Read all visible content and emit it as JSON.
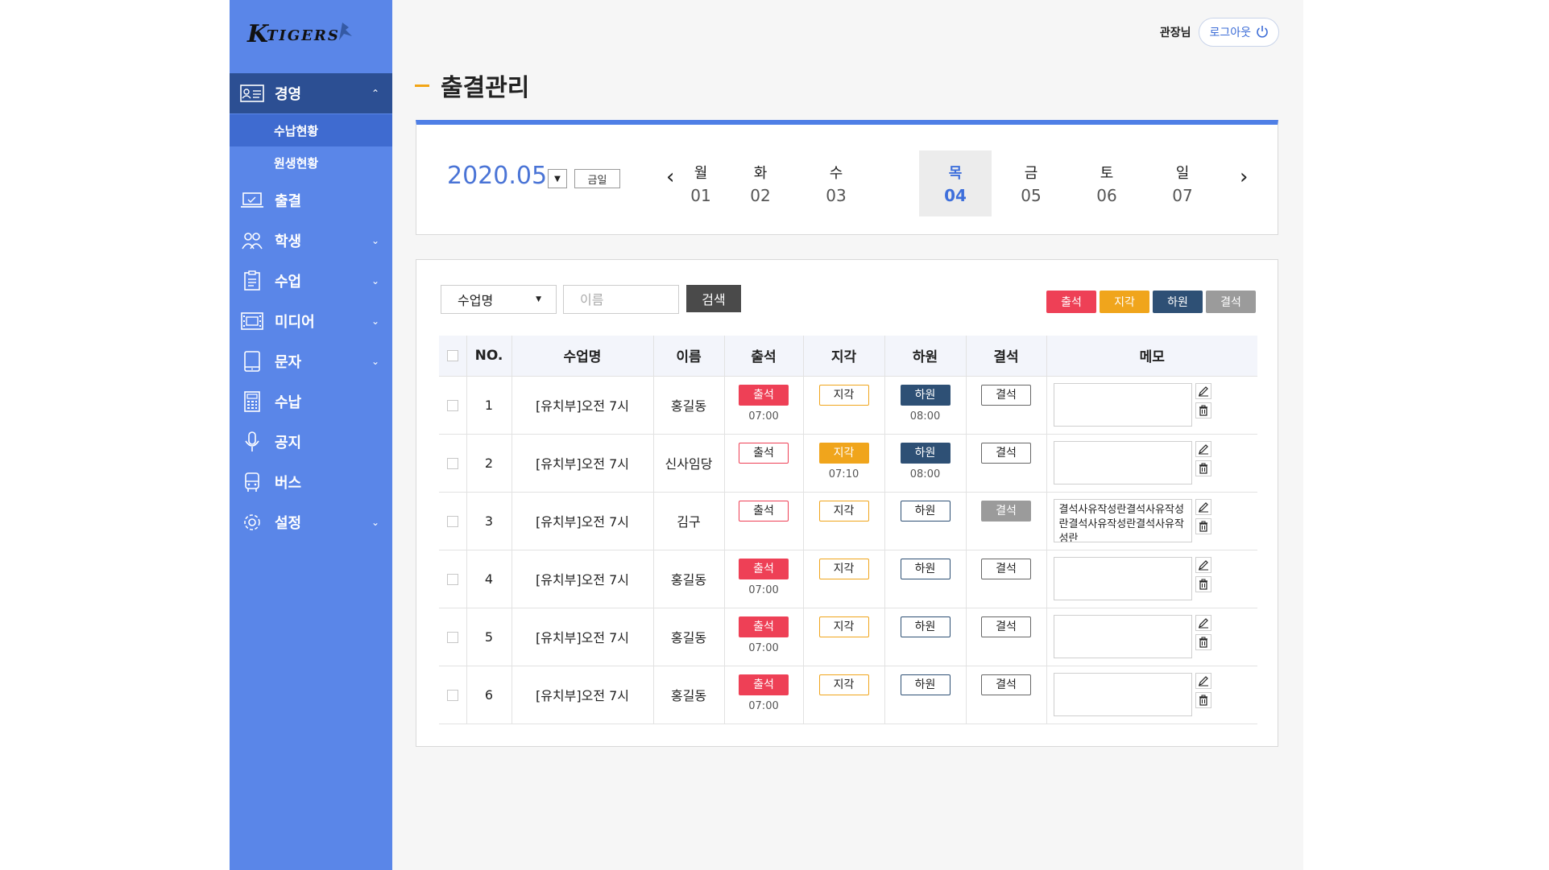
{
  "brand": {
    "logo_text": "K TIGERS"
  },
  "header": {
    "user": "관장님",
    "logout_label": "로그아웃"
  },
  "sidebar": {
    "items": [
      {
        "label": "경영",
        "icon": "id-card-icon",
        "expanded": true,
        "sub": [
          "수납현황",
          "원생현황"
        ]
      },
      {
        "label": "출결",
        "icon": "laptop-icon"
      },
      {
        "label": "학생",
        "icon": "users-icon",
        "has_children": true
      },
      {
        "label": "수업",
        "icon": "clipboard-icon",
        "has_children": true
      },
      {
        "label": "미디어",
        "icon": "media-icon",
        "has_children": true
      },
      {
        "label": "문자",
        "icon": "tablet-icon",
        "has_children": true
      },
      {
        "label": "수납",
        "icon": "calculator-icon"
      },
      {
        "label": "공지",
        "icon": "microphone-icon"
      },
      {
        "label": "버스",
        "icon": "bus-icon"
      },
      {
        "label": "설정",
        "icon": "gear-icon",
        "has_children": true
      }
    ]
  },
  "page": {
    "title": "출결관리"
  },
  "calendar": {
    "month": "2020.05",
    "today_label": "금일",
    "days": [
      {
        "dow": "월",
        "num": "01"
      },
      {
        "dow": "화",
        "num": "02"
      },
      {
        "dow": "수",
        "num": "03"
      },
      {
        "dow": "목",
        "num": "04",
        "selected": true
      },
      {
        "dow": "금",
        "num": "05"
      },
      {
        "dow": "토",
        "num": "06"
      },
      {
        "dow": "일",
        "num": "07"
      }
    ]
  },
  "filters": {
    "class_select": "수업명",
    "name_placeholder": "이름",
    "search_label": "검색"
  },
  "legend": [
    {
      "label": "출석",
      "color": "#ee4056"
    },
    {
      "label": "지각",
      "color": "#f0a51c"
    },
    {
      "label": "하원",
      "color": "#2e5075"
    },
    {
      "label": "결석",
      "color": "#9b9b9b"
    }
  ],
  "table": {
    "columns": [
      "NO.",
      "수업명",
      "이름",
      "출석",
      "지각",
      "하원",
      "결석",
      "메모"
    ],
    "button_labels": {
      "attend": "출석",
      "late": "지각",
      "leave": "하원",
      "absent": "결석"
    },
    "rows": [
      {
        "no": "1",
        "class": "[유치부]오전 7시",
        "name": "홍길동",
        "attend": true,
        "attend_time": "07:00",
        "late": false,
        "late_time": "",
        "leave": true,
        "leave_time": "08:00",
        "absent": false,
        "memo": ""
      },
      {
        "no": "2",
        "class": "[유치부]오전 7시",
        "name": "신사임당",
        "attend": false,
        "attend_time": "",
        "late": true,
        "late_time": "07:10",
        "leave": true,
        "leave_time": "08:00",
        "absent": false,
        "memo": ""
      },
      {
        "no": "3",
        "class": "[유치부]오전 7시",
        "name": "김구",
        "attend": false,
        "attend_time": "",
        "late": false,
        "late_time": "",
        "leave": false,
        "leave_time": "",
        "absent": true,
        "memo": "결석사유작성란결석사유작성란결석사유작성란결석사유작성란"
      },
      {
        "no": "4",
        "class": "[유치부]오전 7시",
        "name": "홍길동",
        "attend": true,
        "attend_time": "07:00",
        "late": false,
        "late_time": "",
        "leave": false,
        "leave_time": "",
        "absent": false,
        "memo": ""
      },
      {
        "no": "5",
        "class": "[유치부]오전 7시",
        "name": "홍길동",
        "attend": true,
        "attend_time": "07:00",
        "late": false,
        "late_time": "",
        "leave": false,
        "leave_time": "",
        "absent": false,
        "memo": ""
      },
      {
        "no": "6",
        "class": "[유치부]오전 7시",
        "name": "홍길동",
        "attend": true,
        "attend_time": "07:00",
        "late": false,
        "late_time": "",
        "leave": false,
        "leave_time": "",
        "absent": false,
        "memo": ""
      }
    ]
  }
}
